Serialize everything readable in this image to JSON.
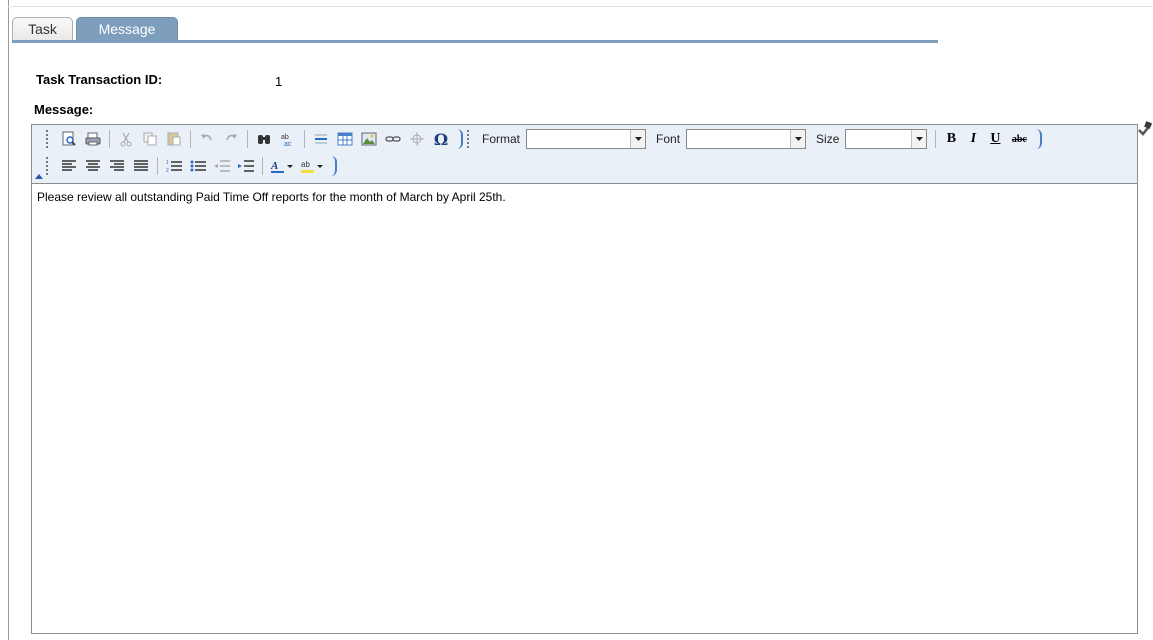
{
  "tabs": [
    {
      "label": "Task",
      "active": false
    },
    {
      "label": "Message",
      "active": true
    }
  ],
  "fields": {
    "transaction_id_label": "Task Transaction ID:",
    "transaction_id_value": "1",
    "message_label": "Message:"
  },
  "toolbar": {
    "format_label": "Format",
    "format_value": "",
    "font_label": "Font",
    "font_value": "",
    "size_label": "Size",
    "size_value": "",
    "bold": "B",
    "italic": "I",
    "underline": "U",
    "strike": "abc",
    "special_char": "Ω",
    "find_icon": "binoculars-icon",
    "spell_icon": "spellcheck-icon"
  },
  "editor": {
    "content": "Please review all outstanding Paid Time Off reports for the month of March by April 25th."
  },
  "colors": {
    "tab_active": "#7e9ebe",
    "toolbar_bg": "#eaf0f8",
    "border": "#8d8d8d"
  }
}
